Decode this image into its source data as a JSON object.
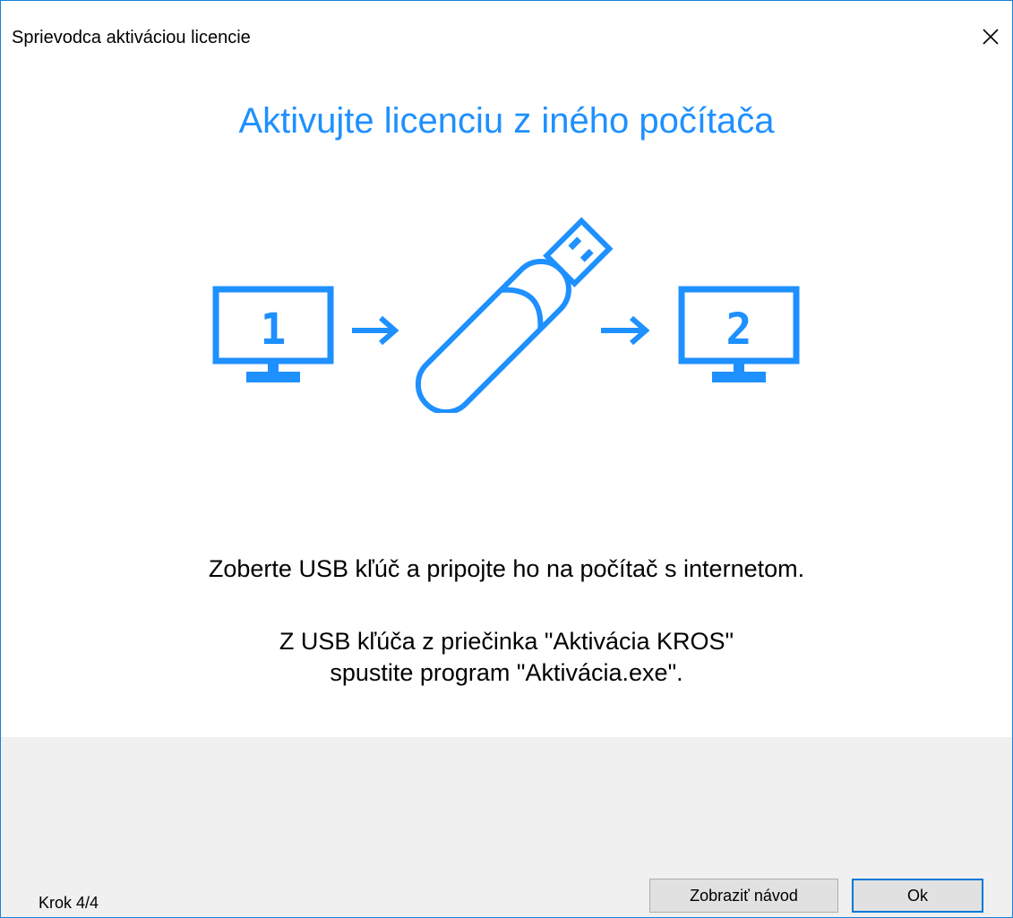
{
  "window": {
    "title": "Sprievodca aktiváciou licencie",
    "close_glyph": "✕"
  },
  "heading": "Aktivujte licenciu z iného počítača",
  "illustration": {
    "monitor_1_label": "1",
    "monitor_2_label": "2",
    "icons": [
      "monitor-icon",
      "arrow-right-icon",
      "usb-key-icon",
      "arrow-right-icon",
      "monitor-icon"
    ],
    "accent_color": "#1e90ff"
  },
  "instructions": {
    "line1": "Zoberte USB kľúč a pripojte ho na počítač s internetom.",
    "line2": "Z USB kľúča z priečinka \"Aktivácia KROS\"",
    "line3": "spustite program \"Aktivácia.exe\"."
  },
  "footer": {
    "step_label": "Krok 4/4",
    "guide_button": "Zobraziť návod",
    "ok_button": "Ok"
  }
}
